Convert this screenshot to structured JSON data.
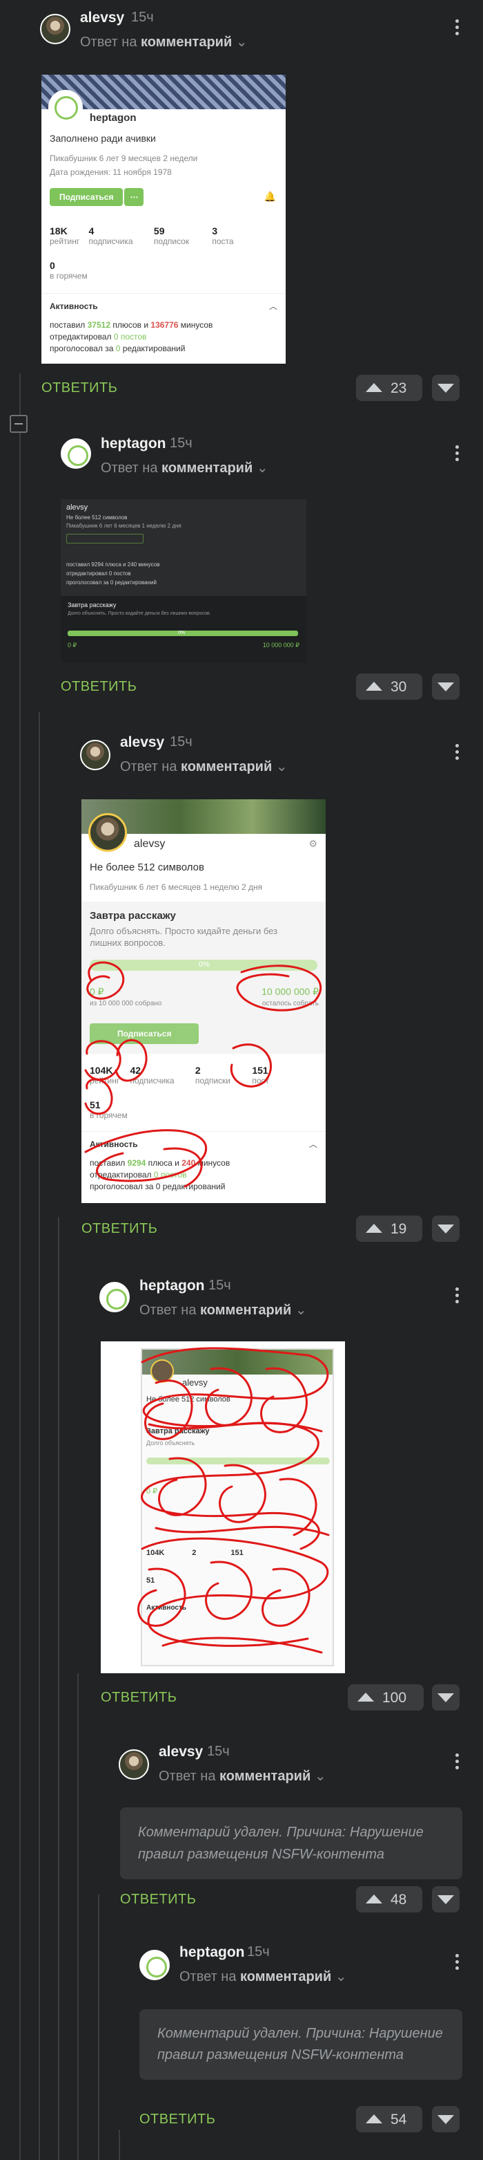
{
  "reply_to_prefix": "Ответ на",
  "reply_to_word": "комментарий",
  "reply_label": "ОТВЕТИТЬ",
  "comments": [
    {
      "author": "alevsy",
      "time": "15ч",
      "votes": "23"
    },
    {
      "author": "heptagon",
      "time": "15ч",
      "votes": "30"
    },
    {
      "author": "alevsy",
      "time": "15ч",
      "votes": "19"
    },
    {
      "author": "heptagon",
      "time": "15ч",
      "votes": "100"
    },
    {
      "author": "alevsy",
      "time": "15ч",
      "votes": "48",
      "deleted": "Комментарий удален. Причина: Нарушение правил размещения NSFW-контента"
    },
    {
      "author": "heptagon",
      "time": "15ч",
      "votes": "54",
      "deleted": "Комментарий удален. Причина: Нарушение правил размещения NSFW-контента"
    }
  ],
  "card1": {
    "user": "heptagon",
    "status": "Заполнено ради ачивки",
    "line1": "Пикабушник 6 лет 9 месяцев 2 недели",
    "line2": "Дата рождения: 11 ноября 1978",
    "subscribe": "Подписаться",
    "stats": [
      {
        "value": "18K",
        "label": "рейтинг"
      },
      {
        "value": "4",
        "label": "подписчика"
      },
      {
        "value": "59",
        "label": "подписок"
      },
      {
        "value": "3",
        "label": "поста"
      }
    ],
    "hot_value": "0",
    "hot_label": "в горячем",
    "activity": "Активность",
    "act1_a": "поставил ",
    "act1_plus": "37512",
    "act1_b": " плюсов и ",
    "act1_minus": "136776",
    "act1_c": " минусов",
    "act2_a": "отредактировал ",
    "act2_val": "0 постов",
    "act3_a": "проголосовал за ",
    "act3_val": "0",
    "act3_b": " редактирований"
  },
  "card2": {
    "user": "alevsy",
    "line0": "Не более 512 символов",
    "line1": "Пикабушник 6 лет 6 месяцев 1 неделю 2 дня",
    "act1": "поставил 9294 плюса и 240 минусов",
    "act2": "отредактировал 0 постов",
    "act3": "проголосовал за 0 редактирований",
    "fund_title": "Завтра расскажу",
    "fund_desc": "Долго объяснять. Просто кидайте деньги без лишних вопросов.",
    "progress": "0%",
    "from": "0 ₽",
    "to": "10 000 000 ₽"
  },
  "card3": {
    "user": "alevsy",
    "line0": "Не более 512 символов",
    "line1": "Пикабушник 6 лет 6 месяцев 1 неделю 2 дня",
    "fund_title": "Завтра расскажу",
    "fund_desc": "Долго объяснять. Просто кидайте деньги без лишних вопросов.",
    "progress": "0%",
    "from": "0 ₽",
    "from_sub": "из 10 000 000 собрано",
    "to": "10 000 000 ₽",
    "to_sub": "осталось собрать",
    "subscribe": "Подписаться",
    "stats": [
      {
        "value": "104K",
        "label": "рейтинг"
      },
      {
        "value": "42",
        "label": "подписчика"
      },
      {
        "value": "2",
        "label": "подписки"
      },
      {
        "value": "151",
        "label": "пост"
      }
    ],
    "hot_value": "51",
    "hot_label": "в горячем",
    "activity": "Активность",
    "act1_a": "поставил ",
    "act1_plus": "9294",
    "act1_b": " плюса и ",
    "act1_minus": "240",
    "act1_c": " минусов",
    "act2_a": "отредактировал ",
    "act2_val": "0 постов",
    "act3": "проголосовал за 0 редактирований"
  },
  "card4": {
    "user": "alevsy",
    "line0": "Не более 512 символов",
    "fund_title": "Завтра расскажу",
    "fund_desc": "Долго объяснять",
    "from": "0 ₽",
    "stats": [
      {
        "value": "104K"
      },
      {
        "value": "2"
      },
      {
        "value": "151"
      }
    ],
    "hot_value": "51",
    "activity": "Активность"
  }
}
